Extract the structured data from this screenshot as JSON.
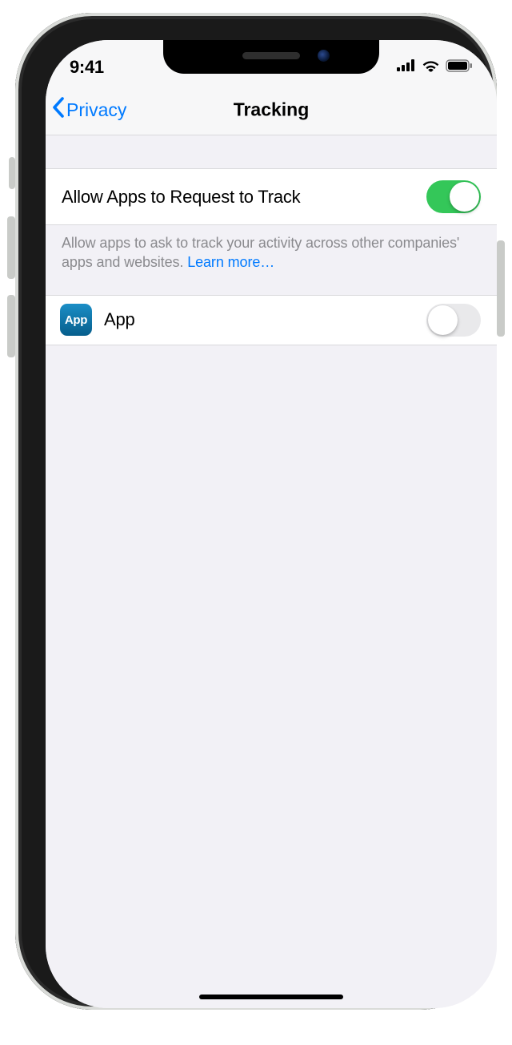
{
  "status": {
    "time": "9:41"
  },
  "nav": {
    "back_label": "Privacy",
    "title": "Tracking"
  },
  "settings": {
    "allow_track": {
      "label": "Allow Apps to Request to Track",
      "on": true,
      "footer_text": "Allow apps to ask to track your activity across other companies' apps and websites. ",
      "learn_more_label": "Learn more…"
    },
    "apps": [
      {
        "name": "App",
        "icon_text": "App",
        "on": false
      }
    ]
  }
}
